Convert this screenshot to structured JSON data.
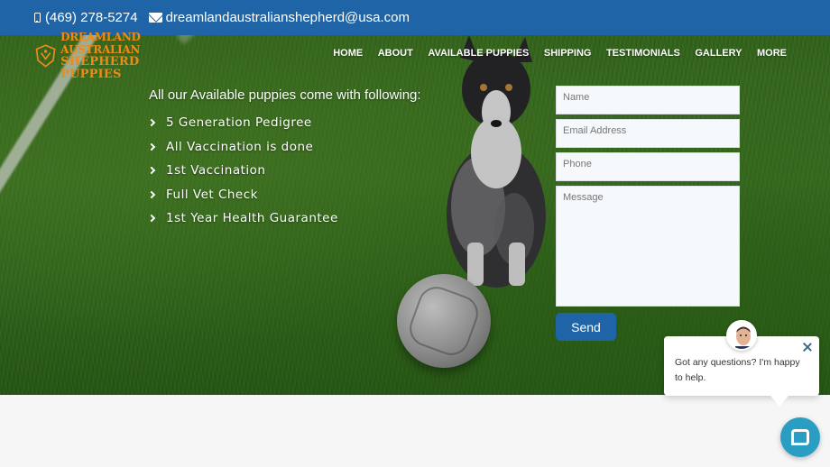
{
  "topbar": {
    "phone": "(469) 278-5274",
    "email": "dreamlandaustralianshepherd@usa.com"
  },
  "logo": {
    "line1": "DREAMLAND AUSTRALIAN",
    "line2": "SHEPHERD PUPPIES"
  },
  "nav": {
    "items": [
      {
        "label": "HOME"
      },
      {
        "label": "ABOUT"
      },
      {
        "label": "AVAILABLE PUPPIES"
      },
      {
        "label": "SHIPPING"
      },
      {
        "label": "TESTIMONIALS"
      },
      {
        "label": "GALLERY"
      },
      {
        "label": "MORE"
      }
    ]
  },
  "features": {
    "intro": "All our Available puppies come with following:",
    "items": [
      "5 Generation Pedigree",
      "All Vaccination is done",
      "1st Vaccination",
      "Full Vet Check",
      "1st Year Health Guarantee"
    ]
  },
  "form": {
    "name_placeholder": "Name",
    "email_placeholder": "Email Address",
    "phone_placeholder": "Phone",
    "message_placeholder": "Message",
    "send_label": "Send"
  },
  "chat": {
    "message": "Got any questions? I'm happy to help."
  },
  "colors": {
    "brand_blue": "#1f64a6",
    "logo_orange": "#f08a16",
    "chat_teal": "#2a9ec2"
  }
}
